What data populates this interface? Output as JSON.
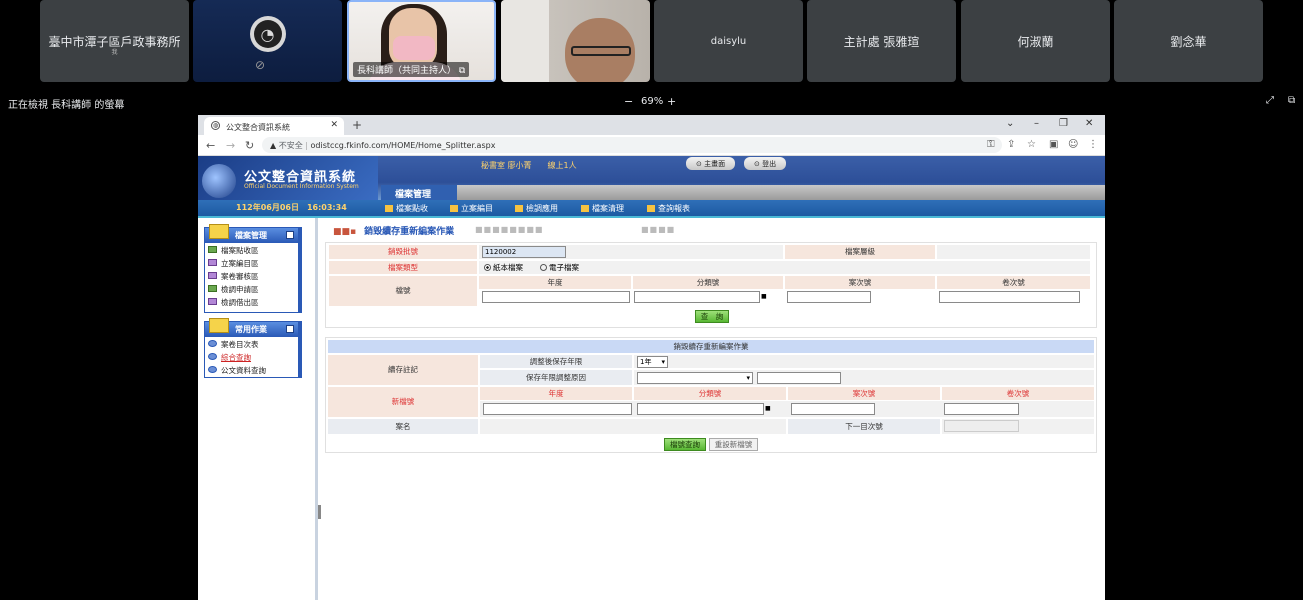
{
  "meet": {
    "participants": [
      {
        "name": "臺中市潭子區戶政事務所",
        "sub": "我"
      },
      {
        "name": ""
      },
      {
        "name": "長科講師（共同主持人）"
      },
      {
        "name": ""
      },
      {
        "name": "daisylu"
      },
      {
        "name": "主計處 張雅瑄"
      },
      {
        "name": "何淑蘭"
      },
      {
        "name": "劉念華"
      }
    ],
    "viewing_text": "正在檢視 長科講師 的螢幕",
    "zoom_minus": "−",
    "zoom_value": "69%",
    "zoom_plus": "+"
  },
  "browser": {
    "tab_title": "公文整合資訊系統",
    "tab_close": "✕",
    "new_tab": "+",
    "security_label": "不安全",
    "url": "odistccg.fkinfo.com/HOME/Home_Splitter.aspx"
  },
  "app": {
    "logo_title": "公文整合資訊系統",
    "logo_subtitle": "Official Document Information System",
    "user_info": "秘書室 廖小菁　　線上1人",
    "home_button": "主畫面",
    "logout_button": "登出",
    "module_tab": "檔案管理",
    "date_time": "112年06月06日　16:03:34",
    "menu": [
      "檔案點收",
      "立案編目",
      "檢調應用",
      "檔案清理",
      "查詢報表"
    ]
  },
  "sidebar": {
    "box1_title": "檔案管理",
    "box1_items": [
      "檔案點收區",
      "立案編目區",
      "案卷審核區",
      "檢調申請區",
      "檢調借出區"
    ],
    "box2_title": "常用作業",
    "box2_items": [
      "案卷目次表",
      "綜合查詢",
      "公文資料查詢"
    ]
  },
  "form1": {
    "page_title": "銷毀續存重新編案作業",
    "batch_label": "銷毀批號",
    "batch_value": "1120002",
    "level_label": "檔案層級",
    "type_label": "檔案類型",
    "type_paper": "紙本檔案",
    "type_electronic": "電子檔案",
    "fileno_label": "檔號",
    "col_year": "年度",
    "col_class": "分類號",
    "col_case": "案次號",
    "col_vol": "卷次號",
    "class_suffix": "■",
    "query_button": "查　詢"
  },
  "form2": {
    "section_title": "銷毀續存重新編案作業",
    "note_label": "續存註記",
    "retention_label": "調整後保存年限",
    "retention_value": "1年",
    "reason_label": "保存年限調整原因",
    "new_fileno_label": "新檔號",
    "col_year": "年度",
    "col_class": "分類號",
    "col_case": "案次號",
    "col_vol": "卷次號",
    "class_suffix": "■",
    "case_name_label": "案名",
    "next_vol_label": "下一目次號",
    "query_fileno_button": "檔號查詢",
    "reset_button": "重設新檔號"
  }
}
